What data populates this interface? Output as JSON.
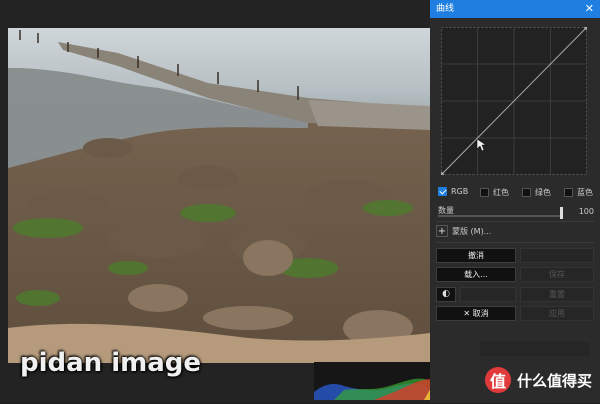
{
  "panel": {
    "title": "曲线",
    "close_glyph": "✕",
    "channels": [
      {
        "label": "RGB",
        "checked": true
      },
      {
        "label": "红色",
        "checked": false
      },
      {
        "label": "绿色",
        "checked": false
      },
      {
        "label": "蓝色",
        "checked": false
      }
    ],
    "amount_label": "数量",
    "amount_value": "100",
    "preset_label": "蒙版 (M)...",
    "buttons": {
      "undo": "撤消",
      "load": "载入...",
      "cancel": "取消",
      "save": "保存",
      "reset": "重置",
      "apply": "应用"
    }
  },
  "watermark": "pidan image",
  "histogram_close": "✕",
  "logo": {
    "text": "什么值得买",
    "badge": "值"
  },
  "colors": {
    "accent": "#1f7fe0",
    "logo_red": "#e03a3a"
  }
}
